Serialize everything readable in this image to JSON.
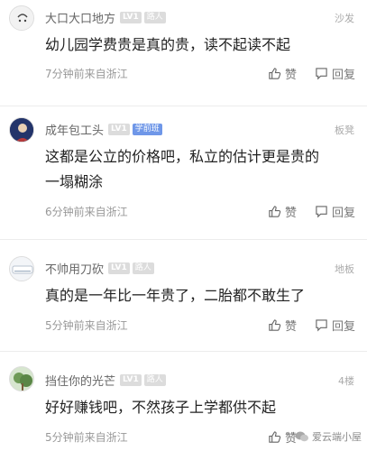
{
  "comments": [
    {
      "username": "大口大口地方",
      "level": "LV1",
      "tag": "路人",
      "floor": "沙发",
      "text": "幼儿园学费贵是真的贵，读不起读不起",
      "meta": "7分钟前来自浙江",
      "like_label": "赞",
      "reply_label": "回复"
    },
    {
      "username": "成年包工头",
      "level": "LV1",
      "tag": "学前班",
      "floor": "板凳",
      "text_line1": "这都是公立的价格吧，私立的估计更是贵的",
      "text_line2": "一塌糊涂",
      "meta": "6分钟前来自浙江",
      "like_label": "赞",
      "reply_label": "回复"
    },
    {
      "username": "不帅用刀砍",
      "level": "LV1",
      "tag": "路人",
      "floor": "地板",
      "text": "真的是一年比一年贵了，二胎都不敢生了",
      "meta": "5分钟前来自浙江",
      "like_label": "赞",
      "reply_label": "回复"
    },
    {
      "username": "挡住你的光芒",
      "level": "LV1",
      "tag": "路人",
      "floor": "4楼",
      "text": "好好赚钱吧，不然孩子上学都供不起",
      "meta": "5分钟前来自浙江",
      "like_label": "赞"
    }
  ],
  "watermark": "爱云端小屋",
  "colors": {
    "badge_gray": "#dcdcdc",
    "badge_blue": "#6f97e8",
    "text_main": "#222222",
    "text_meta": "#999999"
  }
}
